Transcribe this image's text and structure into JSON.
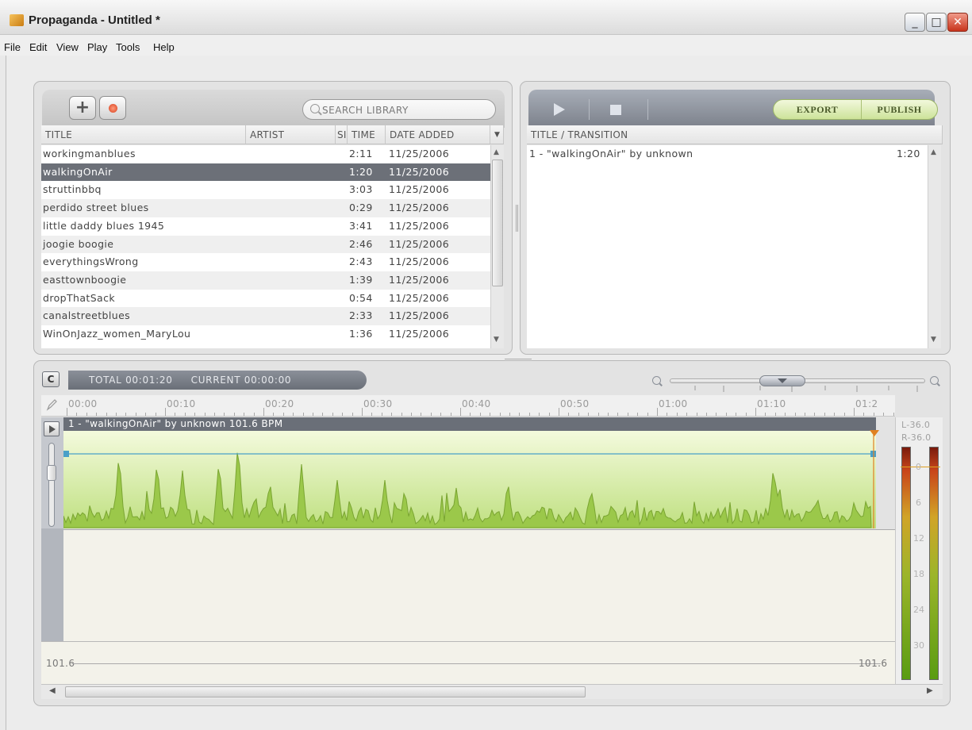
{
  "window": {
    "title": "Propaganda - Untitled *"
  },
  "menu": [
    "File",
    "Edit",
    "View",
    "Play",
    "Tools",
    "Help"
  ],
  "library": {
    "search_placeholder": "SEARCH LIBRARY",
    "columns": {
      "title": "TITLE",
      "artist": "ARTIST",
      "size": "SI",
      "time": "TIME",
      "date_added": "DATE ADDED"
    },
    "rows": [
      {
        "title": "workingmanblues",
        "artist": "",
        "time": "2:11",
        "date": "11/25/2006"
      },
      {
        "title": "walkingOnAir",
        "artist": "",
        "time": "1:20",
        "date": "11/25/2006",
        "selected": true
      },
      {
        "title": "struttinbbq",
        "artist": "",
        "time": "3:03",
        "date": "11/25/2006"
      },
      {
        "title": "perdido street blues",
        "artist": "",
        "time": "0:29",
        "date": "11/25/2006"
      },
      {
        "title": "little daddy blues 1945",
        "artist": "",
        "time": "3:41",
        "date": "11/25/2006"
      },
      {
        "title": "joogie boogie",
        "artist": "",
        "time": "2:46",
        "date": "11/25/2006"
      },
      {
        "title": "everythingsWrong",
        "artist": "",
        "time": "2:43",
        "date": "11/25/2006"
      },
      {
        "title": "easttownboogie",
        "artist": "",
        "time": "1:39",
        "date": "11/25/2006"
      },
      {
        "title": "dropThatSack",
        "artist": "",
        "time": "0:54",
        "date": "11/25/2006"
      },
      {
        "title": "canalstreetblues",
        "artist": "",
        "time": "2:33",
        "date": "11/25/2006"
      },
      {
        "title": "WinOnJazz_women_MaryLou",
        "artist": "",
        "time": "1:36",
        "date": "11/25/2006"
      }
    ]
  },
  "playlist": {
    "export_label": "EXPORT",
    "publish_label": "PUBLISH",
    "column_title": "TITLE / TRANSITION",
    "items": [
      {
        "title": "1 - \"walkingOnAir\" by unknown",
        "time": "1:20"
      }
    ]
  },
  "timeline": {
    "c_label": "C",
    "total_label": "TOTAL 00:01:20",
    "current_label": "CURRENT 00:00:00",
    "ruler_labels": [
      "00:00",
      "00:10",
      "00:20",
      "00:30",
      "00:40",
      "00:50",
      "01:00",
      "01:10",
      "01:2"
    ],
    "clip_label": "1 - \"walkingOnAir\" by unknown 101.6 BPM",
    "tempo_start": "101.6",
    "tempo_end": "101.6"
  },
  "meter": {
    "left_level": "L-36.0",
    "right_level": "R-36.0",
    "scale": [
      "0",
      "6",
      "12",
      "18",
      "24",
      "30"
    ]
  },
  "colors": {
    "selection": "#6c7078",
    "waveform_fill": "#9bc84a",
    "waveform_bg": "#e5f3b8",
    "envelope": "#4aa0c8",
    "accent_green": "#cde39a"
  }
}
